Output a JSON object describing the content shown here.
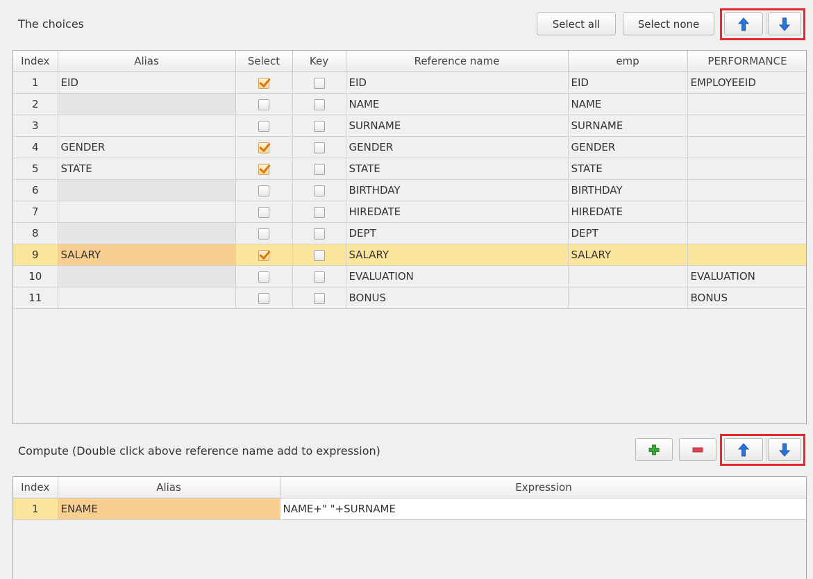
{
  "choices": {
    "title": "The choices",
    "select_all_label": "Select all",
    "select_none_label": "Select none",
    "up_icon": "arrow-up-icon",
    "down_icon": "arrow-down-icon",
    "columns": [
      "Index",
      "Alias",
      "Select",
      "Key",
      "Reference name",
      "emp",
      "PERFORMANCE"
    ],
    "rows": [
      {
        "index": "1",
        "alias": "EID",
        "select": true,
        "key": false,
        "ref": "EID",
        "emp": "EID",
        "performance": "EMPLOYEEID"
      },
      {
        "index": "2",
        "alias": "",
        "select": false,
        "key": false,
        "ref": "NAME",
        "emp": "NAME",
        "performance": ""
      },
      {
        "index": "3",
        "alias": "",
        "select": false,
        "key": false,
        "ref": "SURNAME",
        "emp": "SURNAME",
        "performance": ""
      },
      {
        "index": "4",
        "alias": "GENDER",
        "select": true,
        "key": false,
        "ref": "GENDER",
        "emp": "GENDER",
        "performance": ""
      },
      {
        "index": "5",
        "alias": "STATE",
        "select": true,
        "key": false,
        "ref": "STATE",
        "emp": "STATE",
        "performance": ""
      },
      {
        "index": "6",
        "alias": "",
        "select": false,
        "key": false,
        "ref": "BIRTHDAY",
        "emp": "BIRTHDAY",
        "performance": ""
      },
      {
        "index": "7",
        "alias": "",
        "select": false,
        "key": false,
        "ref": "HIREDATE",
        "emp": "HIREDATE",
        "performance": ""
      },
      {
        "index": "8",
        "alias": "",
        "select": false,
        "key": false,
        "ref": "DEPT",
        "emp": "DEPT",
        "performance": ""
      },
      {
        "index": "9",
        "alias": "SALARY",
        "select": true,
        "key": false,
        "ref": "SALARY",
        "emp": "SALARY",
        "performance": "",
        "selected": true
      },
      {
        "index": "10",
        "alias": "",
        "select": false,
        "key": false,
        "ref": "EVALUATION",
        "emp": "",
        "performance": "EVALUATION"
      },
      {
        "index": "11",
        "alias": "",
        "select": false,
        "key": false,
        "ref": "BONUS",
        "emp": "",
        "performance": "BONUS"
      }
    ]
  },
  "compute": {
    "title": "Compute (Double click above reference name add to expression)",
    "add_icon": "plus-icon",
    "remove_icon": "minus-icon",
    "up_icon": "arrow-up-icon",
    "down_icon": "arrow-down-icon",
    "columns": [
      "Index",
      "Alias",
      "Expression"
    ],
    "rows": [
      {
        "index": "1",
        "alias": "ENAME",
        "expression": "NAME+\" \"+SURNAME",
        "selected": true
      }
    ]
  },
  "colors": {
    "selected_row": "#fbe59d",
    "selected_alias": "#f9cf8f",
    "highlight_box": "#e8262b",
    "check_mark": "#e07800",
    "arrow_blue": "#2a74d8",
    "plus_green": "#3aa53a",
    "minus_red": "#e0454f"
  }
}
